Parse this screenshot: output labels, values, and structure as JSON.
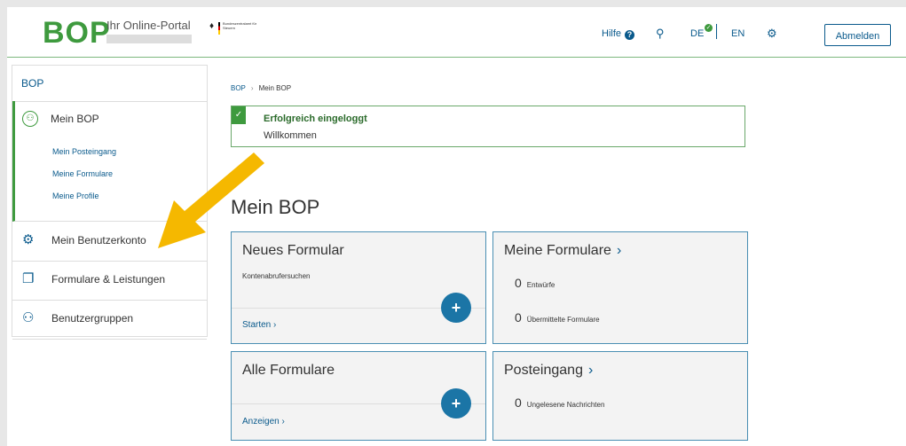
{
  "header": {
    "logo": "BOP",
    "tagline": "Ihr Online-Portal",
    "ministry": "Bundeszentralamt für Steuern",
    "help_label": "Hilfe",
    "help_icon": "question-circle-icon",
    "lang_de": "DE",
    "lang_en": "EN",
    "logout_label": "Abmelden"
  },
  "sidebar": {
    "root": "BOP",
    "main_label": "Mein BOP",
    "sub_items": [
      "Mein Posteingang",
      "Meine Formulare",
      "Meine Profile"
    ],
    "items": [
      {
        "label": "Mein Benutzerkonto",
        "icon": "gear-icon"
      },
      {
        "label": "Formulare & Leistungen",
        "icon": "copy-icon"
      },
      {
        "label": "Benutzergruppen",
        "icon": "users-icon"
      }
    ]
  },
  "breadcrumb": {
    "root": "BOP",
    "current": "Mein BOP"
  },
  "alert": {
    "title": "Erfolgreich eingeloggt",
    "message": "Willkommen"
  },
  "main": {
    "title": "Mein BOP",
    "cards": {
      "new_form": {
        "title": "Neues Formular",
        "subtitle": "Kontenabrufersuchen",
        "link": "Starten"
      },
      "my_forms": {
        "title": "Meine Formulare",
        "drafts_count": "0",
        "drafts_label": "Entwürfe",
        "sent_count": "0",
        "sent_label": "Übermittelte Formulare"
      },
      "all_forms": {
        "title": "Alle Formulare",
        "link": "Anzeigen"
      },
      "inbox": {
        "title": "Posteingang",
        "unread_count": "0",
        "unread_label": "Ungelesene Nachrichten"
      }
    }
  },
  "colors": {
    "brand_green": "#3e9a3e",
    "link_blue": "#0a5a8c",
    "button_blue": "#1b75a6",
    "arrow_yellow": "#f5b800"
  }
}
